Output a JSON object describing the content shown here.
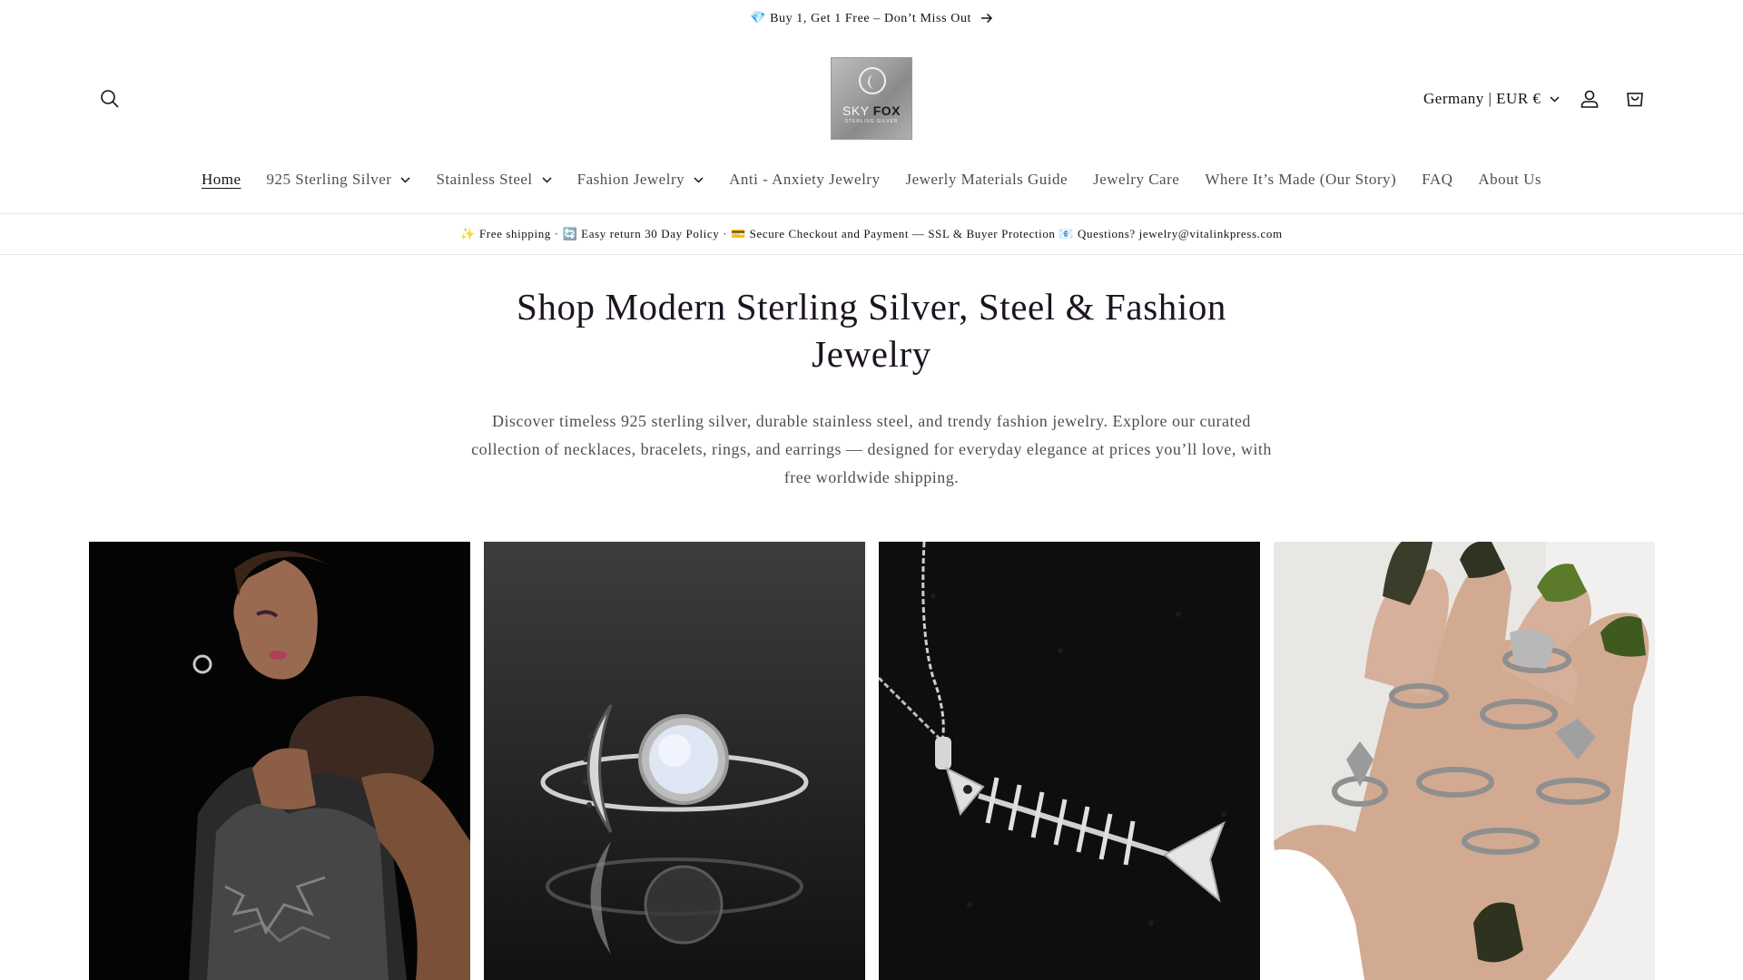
{
  "announcement": {
    "icon": "gem-icon",
    "text": "💎 Buy 1, Get 1 Free – Don’t Miss Out"
  },
  "logo": {
    "brand_light": "SKY ",
    "brand_dark": "FOX",
    "tagline": "STERLING SILVER"
  },
  "header": {
    "locale": "Germany | EUR €"
  },
  "nav": {
    "items": [
      {
        "label": "Home",
        "active": true,
        "dropdown": false
      },
      {
        "label": "925 Sterling Silver",
        "dropdown": true
      },
      {
        "label": "Stainless Steel",
        "dropdown": true
      },
      {
        "label": "Fashion Jewelry",
        "dropdown": true
      },
      {
        "label": "Anti - Anxiety Jewelry",
        "dropdown": false
      },
      {
        "label": "Jewerly Materials Guide",
        "dropdown": false
      },
      {
        "label": "Jewelry Care",
        "dropdown": false
      },
      {
        "label": "Where It’s Made (Our Story)",
        "dropdown": false
      },
      {
        "label": "FAQ",
        "dropdown": false
      },
      {
        "label": "About Us",
        "dropdown": false
      }
    ]
  },
  "infobar": {
    "text": "✨ Free shipping · 🔄 Easy return 30 Day Policy · 💳 Secure Checkout and Payment — SSL & Buyer Protection 📧 Questions? jewelry@vitalinkpress.com"
  },
  "hero": {
    "title": "Shop Modern Sterling Silver, Steel & Fashion Jewelry",
    "description": "Discover timeless 925 sterling silver, durable stainless steel, and trendy fashion jewelry. Explore our curated collection of necklaces, bracelets, rings, and earrings — designed for everyday elegance at prices you’ll love, with free worldwide shipping."
  },
  "colors": {
    "text": "#121212",
    "title": "#1c1420",
    "divider": "#e6e6e6"
  }
}
